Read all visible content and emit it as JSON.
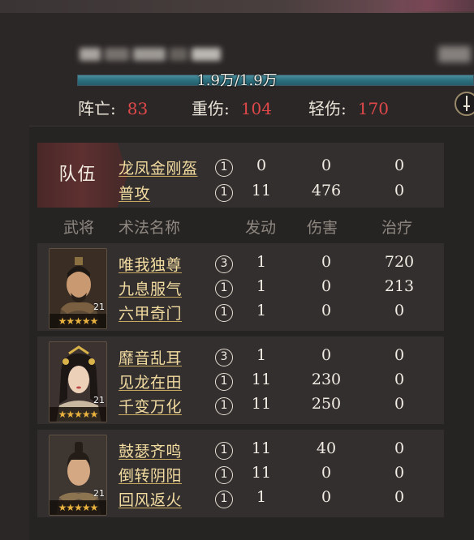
{
  "summary": {
    "hp_text": "1.9万/1.9万",
    "hp_fraction": 1.0,
    "dead_label": "阵亡:",
    "dead_value": "83",
    "heavy_label": "重伤:",
    "heavy_value": "104",
    "light_label": "轻伤:",
    "light_value": "170",
    "info_icon": "sword-icon"
  },
  "team": {
    "tag": "队伍",
    "rows": [
      {
        "skill": "龙凤金刚盔",
        "level": "1",
        "triggers": "0",
        "damage": "0",
        "heal": "0"
      },
      {
        "skill": "普攻",
        "level": "1",
        "triggers": "11",
        "damage": "476",
        "heal": "0"
      }
    ]
  },
  "headers": {
    "general": "武将",
    "skill_name": "术法名称",
    "triggers": "发动",
    "damage": "伤害",
    "heal": "治疗"
  },
  "generals": [
    {
      "level": "21",
      "stars": "★★★★★",
      "skills": [
        {
          "skill": "唯我独尊",
          "level": "3",
          "triggers": "1",
          "damage": "0",
          "heal": "720"
        },
        {
          "skill": "九息服气",
          "level": "1",
          "triggers": "1",
          "damage": "0",
          "heal": "213"
        },
        {
          "skill": "六甲奇门",
          "level": "1",
          "triggers": "1",
          "damage": "0",
          "heal": "0"
        }
      ]
    },
    {
      "level": "21",
      "stars": "★★★★★",
      "skills": [
        {
          "skill": "靡音乱耳",
          "level": "3",
          "triggers": "1",
          "damage": "0",
          "heal": "0"
        },
        {
          "skill": "见龙在田",
          "level": "1",
          "triggers": "11",
          "damage": "230",
          "heal": "0"
        },
        {
          "skill": "千变万化",
          "level": "1",
          "triggers": "11",
          "damage": "250",
          "heal": "0"
        }
      ]
    },
    {
      "level": "21",
      "stars": "★★★★★",
      "skills": [
        {
          "skill": "鼓瑟齐鸣",
          "level": "1",
          "triggers": "11",
          "damage": "40",
          "heal": "0"
        },
        {
          "skill": "倒转阴阳",
          "level": "1",
          "triggers": "11",
          "damage": "0",
          "heal": "0"
        },
        {
          "skill": "回风返火",
          "level": "1",
          "triggers": "1",
          "damage": "0",
          "heal": "0"
        }
      ]
    }
  ]
}
